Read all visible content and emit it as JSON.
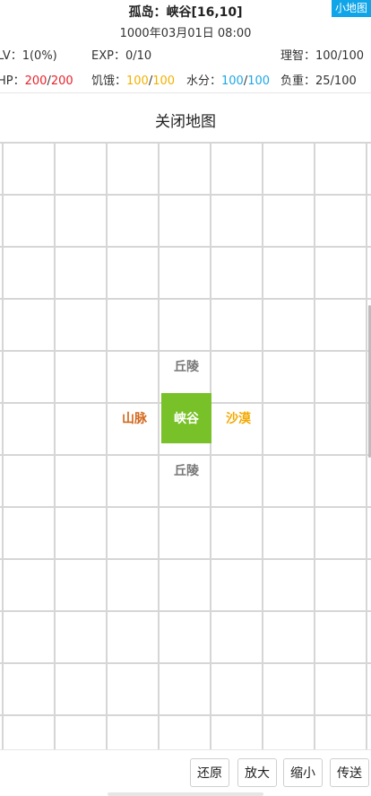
{
  "header": {
    "title": "孤岛：峡谷[16,10]",
    "date": "1000年03月01日 08:00",
    "minimap_label": "小地图"
  },
  "stats": {
    "lv": "LV：1(0%)",
    "exp": "EXP：0/10",
    "sanity": "理智：100/100",
    "hp_label": "HP：",
    "hp_current": "200",
    "hp_max": "200",
    "hunger_label": "饥饿：",
    "hunger_current": "100",
    "hunger_max": "100",
    "water_label": "水分：",
    "water_current": "100",
    "water_max": "100",
    "load": "负重：25/100",
    "sep": "/"
  },
  "map": {
    "close_label": "关闭地图",
    "tiles": {
      "north": "丘陵",
      "center": "峡谷",
      "west": "山脉",
      "east": "沙漠",
      "south": "丘陵"
    },
    "colors": {
      "center_bg": "#78c128",
      "hill": "#777777",
      "mountain": "#d2691e",
      "desert": "#f2a900",
      "grid": "#d6d6d6"
    }
  },
  "toolbar": {
    "restore": "还原",
    "zoom_in": "放大",
    "zoom_out": "缩小",
    "teleport": "传送"
  }
}
